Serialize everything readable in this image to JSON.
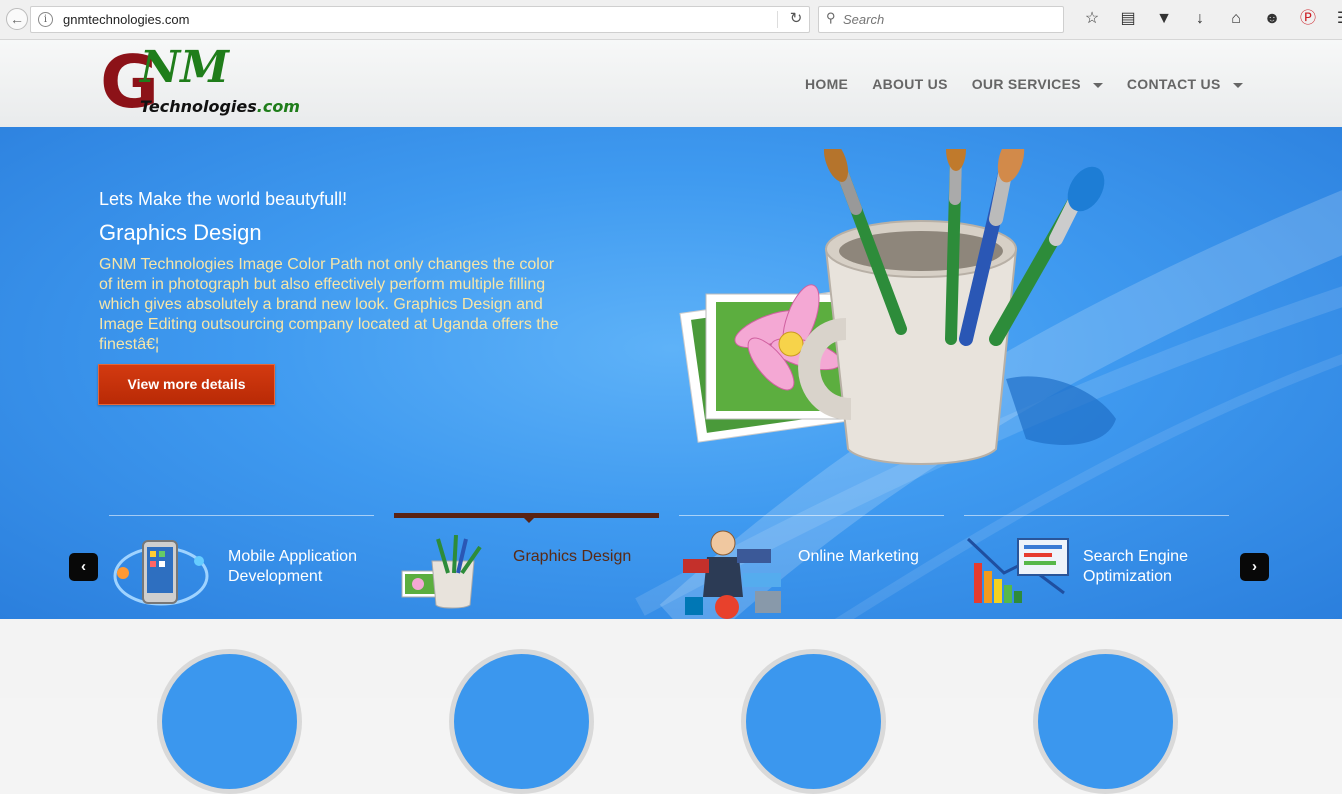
{
  "browser": {
    "url": "gnmtechnologies.com",
    "search_placeholder": "Search"
  },
  "site": {
    "logo": {
      "letter": "G",
      "nm": "NM",
      "tagline": "Technologies",
      "suffix": ".com"
    },
    "nav": [
      {
        "label": "HOME",
        "dropdown": false
      },
      {
        "label": "ABOUT US",
        "dropdown": false
      },
      {
        "label": "OUR SERVICES",
        "dropdown": true
      },
      {
        "label": "CONTACT US",
        "dropdown": true
      }
    ]
  },
  "hero": {
    "tagline": "Lets Make the world beautyfull!",
    "title": "Graphics Design",
    "description": "GNM Technologies Image Color Path not only changes the color of item in photograph but also effectively perform multiple filling which gives absolutely a brand new look. Graphics Design and Image Editing outsourcing company located at Uganda offers the finestâ€¦",
    "button_label": "View more details"
  },
  "services": [
    {
      "label": "Mobile Application Development",
      "active": false,
      "icon": "mobile-app-icon"
    },
    {
      "label": "Graphics Design",
      "active": true,
      "icon": "paint-brushes-icon"
    },
    {
      "label": "Online Marketing",
      "active": false,
      "icon": "social-marketing-icon"
    },
    {
      "label": "Search Engine Optimization",
      "active": false,
      "icon": "seo-chart-icon"
    }
  ],
  "colors": {
    "hero_blue": "#3f9af0",
    "button_red": "#c3300a",
    "logo_red": "#8c1218",
    "logo_green": "#1f7d1a",
    "desc_text": "#f7e6a8"
  }
}
